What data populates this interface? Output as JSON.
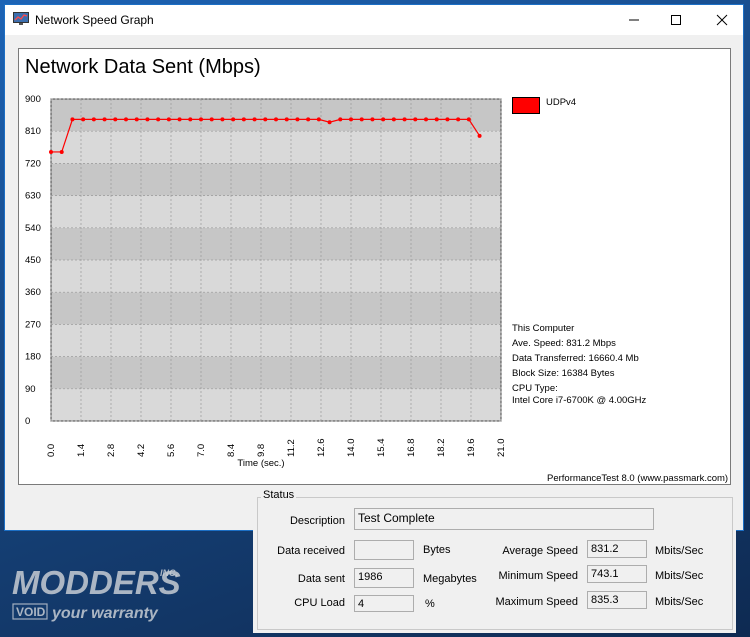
{
  "window": {
    "title": "Network Speed Graph"
  },
  "chart_data": {
    "type": "line",
    "title": "Network Data Sent (Mbps)",
    "xlabel": "Time (sec.)",
    "ylabel": "",
    "x_ticks": [
      "0.0",
      "1.4",
      "2.8",
      "4.2",
      "5.6",
      "7.0",
      "8.4",
      "9.8",
      "11.2",
      "12.6",
      "14.0",
      "15.4",
      "16.8",
      "18.2",
      "19.6",
      "21.0"
    ],
    "y_ticks": [
      "900",
      "810",
      "720",
      "630",
      "540",
      "450",
      "360",
      "270",
      "180",
      "90",
      "0"
    ],
    "xlim": [
      0,
      21.0
    ],
    "ylim": [
      0,
      900
    ],
    "grid": true,
    "legend_position": "right",
    "series": [
      {
        "name": "UDPv4",
        "color": "#ff0000",
        "x": [
          0.0,
          0.5,
          1.0,
          1.5,
          2.0,
          2.5,
          3.0,
          3.5,
          4.0,
          4.5,
          5.0,
          5.5,
          6.0,
          6.5,
          7.0,
          7.5,
          8.0,
          8.5,
          9.0,
          9.5,
          10.0,
          10.5,
          11.0,
          11.5,
          12.0,
          12.5,
          13.0,
          13.5,
          14.0,
          14.5,
          15.0,
          15.5,
          16.0,
          16.5,
          17.0,
          17.5,
          18.0,
          18.5,
          19.0,
          19.5,
          20.0
        ],
        "y": [
          752,
          752,
          843,
          843,
          843,
          843,
          843,
          843,
          843,
          843,
          843,
          843,
          843,
          843,
          843,
          843,
          843,
          843,
          843,
          843,
          843,
          843,
          843,
          843,
          843,
          843,
          835,
          843,
          843,
          843,
          843,
          843,
          843,
          843,
          843,
          843,
          843,
          843,
          843,
          843,
          797
        ]
      }
    ]
  },
  "legend": {
    "series_name": "UDPv4",
    "swatch_color": "#ff0000"
  },
  "info": {
    "computer": "This Computer",
    "ave_speed": "Ave. Speed: 831.2 Mbps",
    "data_transferred": "Data Transferred: 16660.4 Mb",
    "block_size": "Block Size: 16384 Bytes",
    "cpu_type_label": "CPU Type:",
    "cpu_type_value": "Intel Core i7-6700K @ 4.00GHz"
  },
  "credit": "PerformanceTest 8.0 (www.passmark.com)",
  "status": {
    "legend": "Status",
    "description_label": "Description",
    "description_value": "Test Complete",
    "data_received_label": "Data received",
    "data_received_value": "",
    "data_received_unit": "Bytes",
    "data_sent_label": "Data sent",
    "data_sent_value": "1986",
    "data_sent_unit": "Megabytes",
    "cpu_load_label": "CPU Load",
    "cpu_load_value": "4",
    "cpu_load_unit": "%",
    "avg_speed_label": "Average Speed",
    "avg_speed_value": "831.2",
    "avg_speed_unit": "Mbits/Sec",
    "min_speed_label": "Minimum Speed",
    "min_speed_value": "743.1",
    "min_speed_unit": "Mbits/Sec",
    "max_speed_label": "Maximum Speed",
    "max_speed_value": "835.3",
    "max_speed_unit": "Mbits/Sec"
  },
  "watermark": {
    "line1": "MODDERS",
    "line2": "INC.",
    "line3": "VOID",
    "line4": "your warranty"
  }
}
